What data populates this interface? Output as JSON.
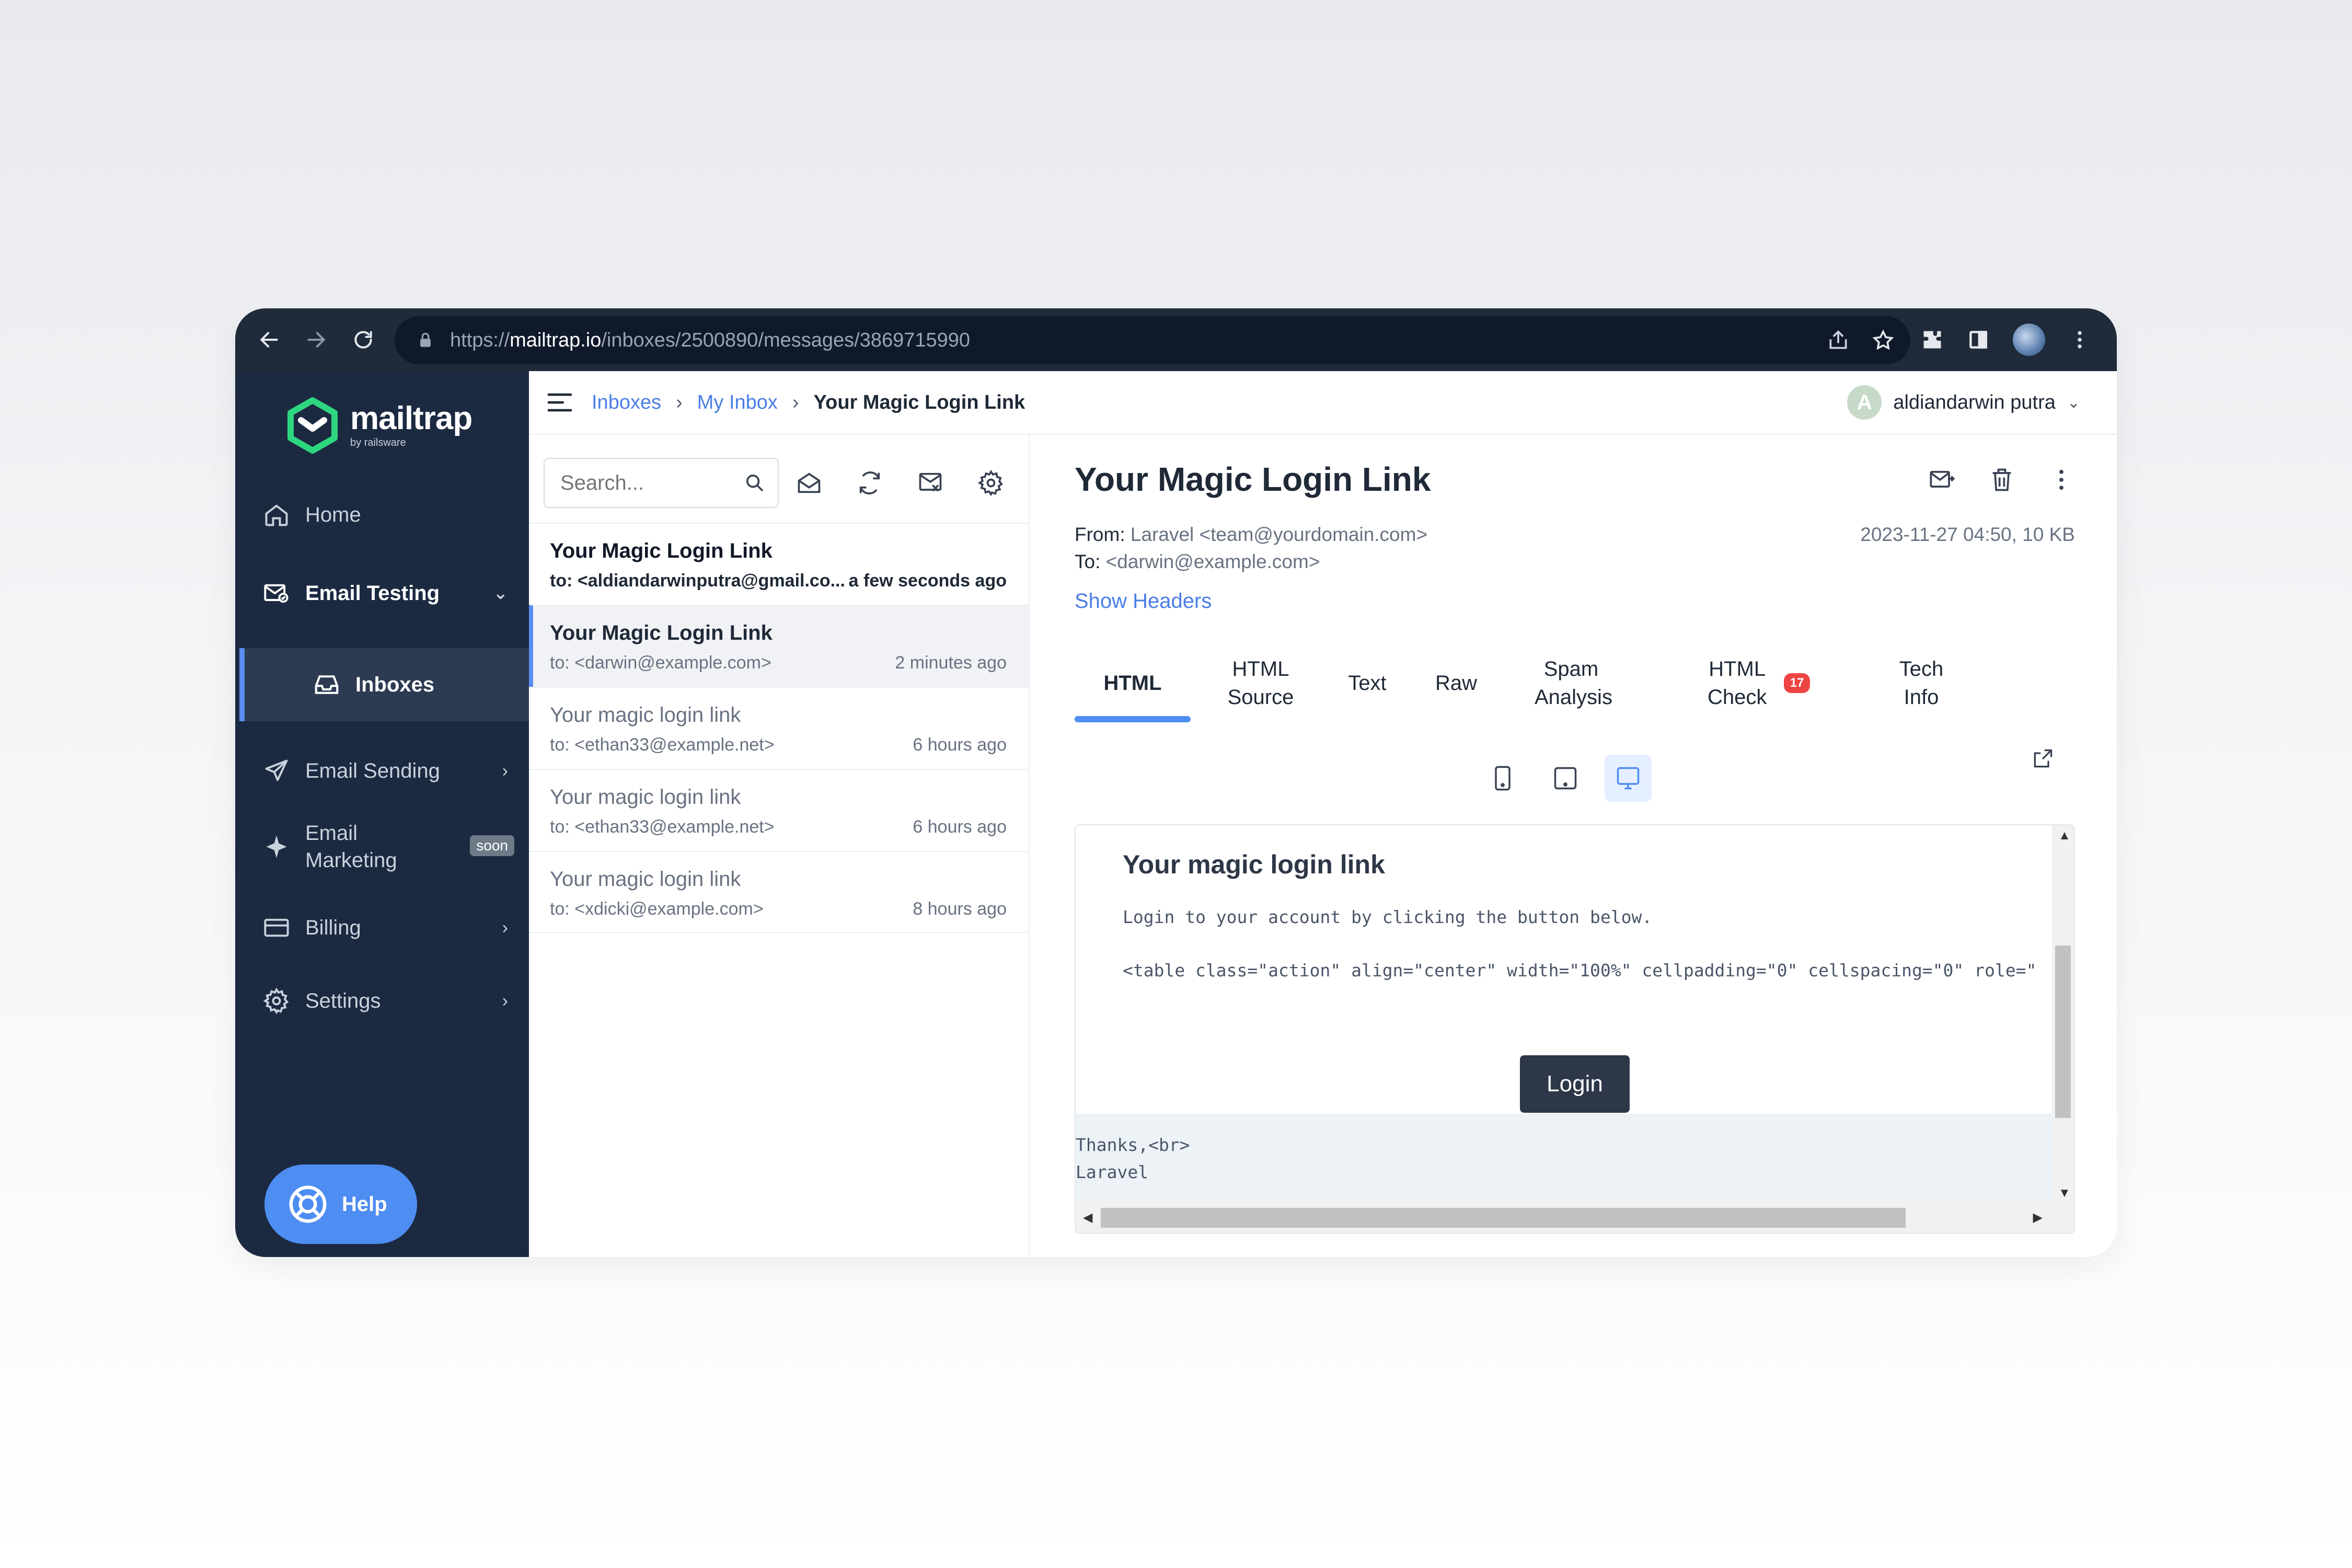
{
  "browser": {
    "url_prefix": "https://",
    "url_host": "mailtrap.io",
    "url_path": "/inboxes/2500890/messages/3869715990"
  },
  "sidebar": {
    "logo_text": "mailtrap",
    "logo_sub": "by railsware",
    "items": [
      {
        "label": "Home"
      },
      {
        "label": "Email Testing"
      },
      {
        "label": "Inboxes"
      },
      {
        "label": "Email Sending"
      },
      {
        "label": "Email Marketing",
        "badge": "soon"
      },
      {
        "label": "Billing"
      },
      {
        "label": "Settings"
      }
    ],
    "help_label": "Help"
  },
  "topbar": {
    "breadcrumbs": [
      "Inboxes",
      "My Inbox",
      "Your Magic Login Link"
    ],
    "user_initial": "A",
    "user_name": "aldiandarwin putra"
  },
  "list": {
    "search_placeholder": "Search...",
    "messages": [
      {
        "subject": "Your Magic Login Link",
        "to": "to: <aldiandarwinputra@gmail.co...",
        "time": "a few seconds ago",
        "state": "unread"
      },
      {
        "subject": "Your Magic Login Link",
        "to": "to: <darwin@example.com>",
        "time": "2 minutes ago",
        "state": "selected"
      },
      {
        "subject": "Your magic login link",
        "to": "to: <ethan33@example.net>",
        "time": "6 hours ago",
        "state": "read"
      },
      {
        "subject": "Your magic login link",
        "to": "to: <ethan33@example.net>",
        "time": "6 hours ago",
        "state": "read"
      },
      {
        "subject": "Your magic login link",
        "to": "to: <xdicki@example.com>",
        "time": "8 hours ago",
        "state": "read"
      }
    ]
  },
  "message": {
    "title": "Your Magic Login Link",
    "from_label": "From:",
    "from_value": "Laravel <team@yourdomain.com>",
    "to_label": "To:",
    "to_value": "<darwin@example.com>",
    "date_size": "2023-11-27 04:50, 10 KB",
    "show_headers": "Show Headers",
    "tabs": [
      {
        "label": "HTML"
      },
      {
        "label": "HTML Source"
      },
      {
        "label": "Text"
      },
      {
        "label": "Raw"
      },
      {
        "label": "Spam Analysis"
      },
      {
        "label": "HTML Check",
        "badge": "17"
      },
      {
        "label": "Tech Info"
      }
    ],
    "preview": {
      "heading": "Your magic login link",
      "line1": "Login to your account by clicking the button below.",
      "line2": "<table class=\"action\" align=\"center\" width=\"100%\" cellpadding=\"0\" cellspacing=\"0\" role=\"",
      "button": "Login",
      "foot1": "Thanks,<br>",
      "foot2": "Laravel"
    }
  },
  "colors": {
    "sidebar_bg": "#1b2a41",
    "accent": "#4e8df1",
    "link": "#4a7ee6",
    "badge_red": "#ef4444"
  }
}
